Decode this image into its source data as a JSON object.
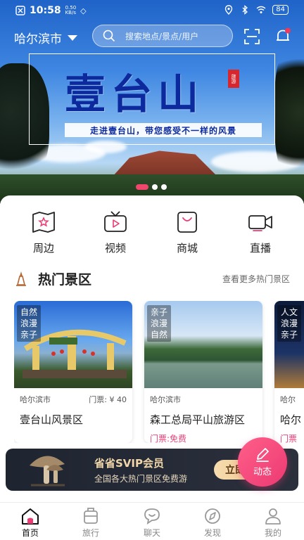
{
  "status": {
    "time": "10:58",
    "net_speed": "0.50\nKB/s",
    "battery": "84"
  },
  "header": {
    "city": "哈尔滨市",
    "search_placeholder": "搜索地点/景点/用户"
  },
  "banner": {
    "title": "壹台山",
    "seal": "旅游",
    "slogan": "走进壹台山，带您感受不一样的风景",
    "slides": 3,
    "active_slide": 1
  },
  "quick_links": [
    {
      "label": "周边",
      "icon": "map-star-icon"
    },
    {
      "label": "视频",
      "icon": "tv-play-icon"
    },
    {
      "label": "商城",
      "icon": "shop-bag-icon"
    },
    {
      "label": "直播",
      "icon": "video-camera-icon"
    }
  ],
  "hot": {
    "title": "热门景区",
    "more": "查看更多热门景区",
    "cards": [
      {
        "tags": "自然\n浪漫\n亲子",
        "city": "哈尔滨市",
        "price": "门票: ¥ 40",
        "name": "壹台山风景区",
        "ticket": ""
      },
      {
        "tags": "亲子\n浪漫\n自然",
        "city": "哈尔滨市",
        "price": "",
        "name": "森工总局平山旅游区",
        "ticket": "门票:免费"
      },
      {
        "tags": "人文\n浪漫\n亲子",
        "city": "哈尔",
        "price": "",
        "name": "哈尔",
        "ticket": "门票"
      }
    ]
  },
  "promo": {
    "title": "省省SVIP会员",
    "subtitle": "全国各大热门景区免费游",
    "button": "立即"
  },
  "fab": {
    "label": "动态"
  },
  "tabs": [
    {
      "label": "首页",
      "icon": "home-icon",
      "active": true
    },
    {
      "label": "旅行",
      "icon": "suitcase-icon",
      "active": false
    },
    {
      "label": "聊天",
      "icon": "chat-icon",
      "active": false
    },
    {
      "label": "发现",
      "icon": "compass-icon",
      "active": false
    },
    {
      "label": "我的",
      "icon": "user-icon",
      "active": false
    }
  ],
  "colors": {
    "accent": "#EC3A72",
    "banner_title": "#0C2A9E",
    "promo_gold": "#F0D6A8"
  }
}
